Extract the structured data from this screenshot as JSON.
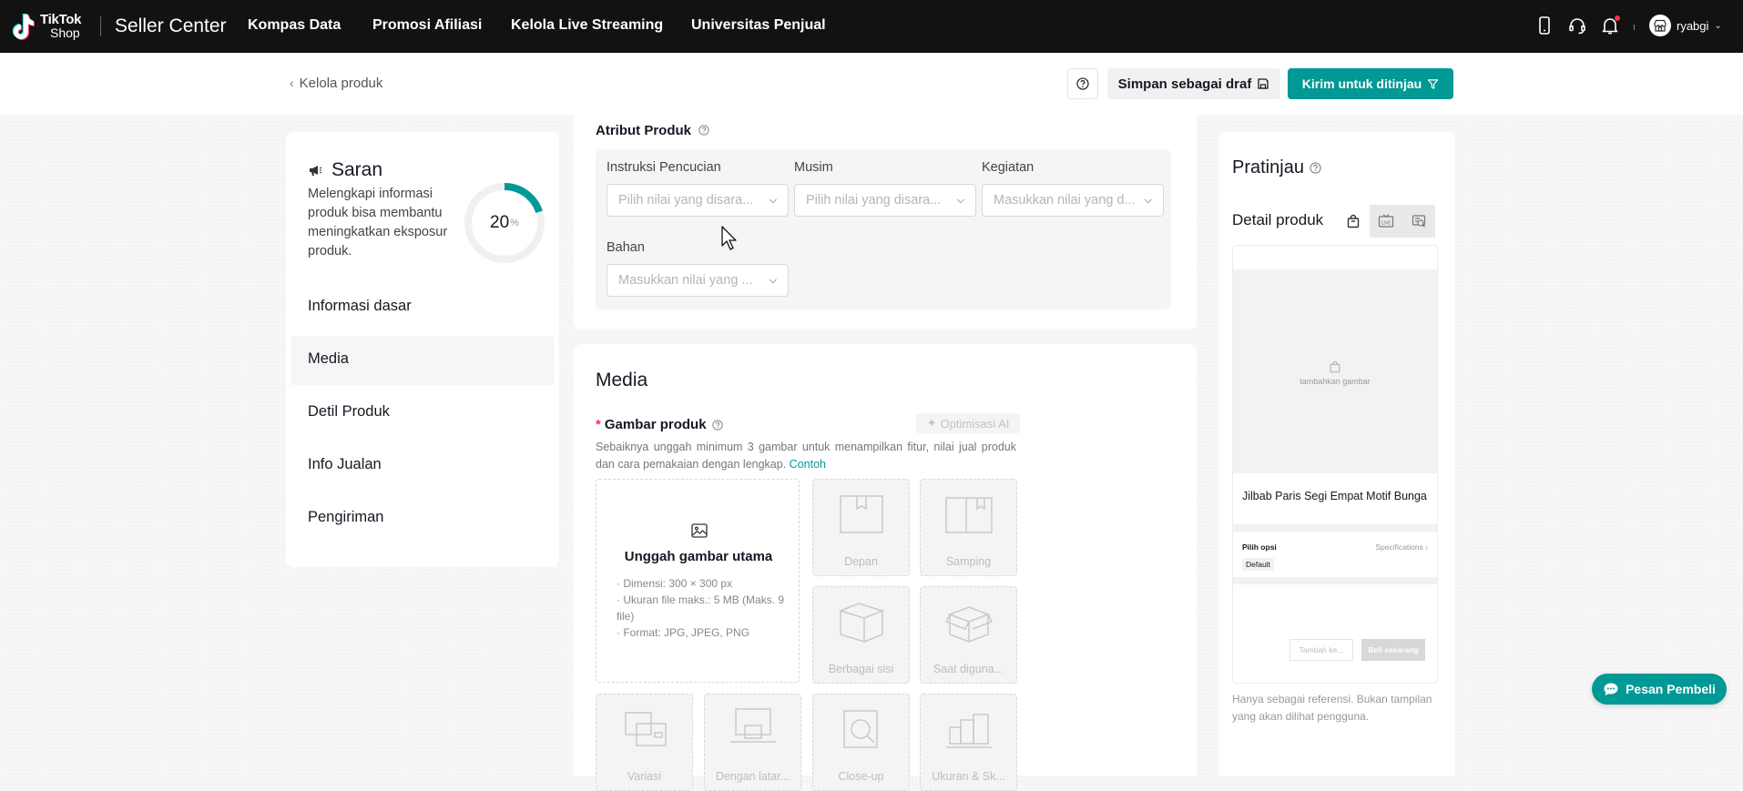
{
  "topbar": {
    "logo_line1": "TikTok",
    "logo_line2": "Shop",
    "brand": "Seller Center",
    "nav": [
      "Kompas Data",
      "Promosi Afiliasi",
      "Kelola Live Streaming",
      "Universitas Penjual"
    ],
    "user": "ryabgi"
  },
  "actionbar": {
    "back": "Kelola produk",
    "draft": "Simpan sebagai draf",
    "submit": "Kirim untuk ditinjau"
  },
  "left": {
    "saran_title": "Saran",
    "saran_text": "Melengkapi informasi produk bisa membantu meningkatkan eksposur produk.",
    "progress_value": "20",
    "progress_unit": "%",
    "progress_fraction": 0.2,
    "items": [
      "Informasi dasar",
      "Media",
      "Detil Produk",
      "Info Jualan",
      "Pengiriman"
    ],
    "active_item": "Media"
  },
  "attributes": {
    "title": "Atribut Produk",
    "fields": [
      {
        "label": "Instruksi Pencucian",
        "placeholder": "Pilih nilai yang disara..."
      },
      {
        "label": "Musim",
        "placeholder": "Pilih nilai yang disara..."
      },
      {
        "label": "Kegiatan",
        "placeholder": "Masukkan nilai yang d..."
      },
      {
        "label": "Bahan",
        "placeholder": "Masukkan nilai yang ..."
      }
    ]
  },
  "media": {
    "title": "Media",
    "image_label": "Gambar produk",
    "ai_button": "Optimisasi AI",
    "desc": "Sebaiknya unggah minimum 3 gambar untuk menampilkan fitur, nilai jual produk dan cara pemakaian dengan lengkap.",
    "desc_link": "Contoh",
    "upload_title": "Unggah gambar utama",
    "upload_specs": [
      "· Dimensi: 300 × 300 px",
      "· Ukuran file maks.: 5 MB (Maks. 9 file)",
      "· Format: JPG, JPEG, PNG"
    ],
    "slots": [
      "Depan",
      "Samping",
      "Berbagai sisi",
      "Saat diguna...",
      "Variasi",
      "Dengan latar...",
      "Close-up",
      "Ukuran & Sk..."
    ]
  },
  "preview": {
    "title": "Pratinjau",
    "subtitle": "Detail produk",
    "image_placeholder": "tambahkan gambar",
    "product_name": "Jilbab Paris Segi Empat Motif Bunga",
    "pilih_opsi": "Pilih opsi",
    "specifications": "Specifications ›",
    "default": "Default",
    "add_cart": "Tambah ke...",
    "buy_now": "Beli sekarang",
    "note": "Hanya sebagai referensi. Bukan tampilan yang akan dilihat pengguna."
  },
  "chat": {
    "label": "Pesan Pembeli"
  },
  "colors": {
    "accent": "#009995",
    "topbar": "#121212",
    "required": "#fe2c55"
  }
}
